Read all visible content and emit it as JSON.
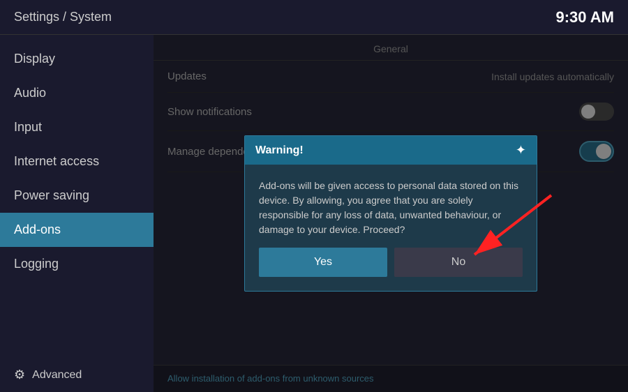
{
  "header": {
    "title": "Settings / System",
    "time": "9:30 AM"
  },
  "sidebar": {
    "items": [
      {
        "label": "Display",
        "active": false
      },
      {
        "label": "Audio",
        "active": false
      },
      {
        "label": "Input",
        "active": false
      },
      {
        "label": "Internet access",
        "active": false
      },
      {
        "label": "Power saving",
        "active": false
      },
      {
        "label": "Add-ons",
        "active": true
      },
      {
        "label": "Logging",
        "active": false
      }
    ],
    "footer": {
      "label": "Advanced",
      "icon": "gear"
    }
  },
  "main": {
    "section": {
      "label": "General"
    },
    "settings": [
      {
        "label": "Updates",
        "value": "Install updates automatically",
        "type": "text"
      },
      {
        "label": "Show notifications",
        "type": "toggle",
        "state": "off"
      },
      {
        "label": "Manage dependencies",
        "type": "toggle",
        "state": "on"
      }
    ],
    "status_bar": {
      "text": "Allow installation of add-ons from unknown sources"
    }
  },
  "dialog": {
    "title": "Warning!",
    "message": "Add-ons will be given access to personal data stored on this device. By allowing, you agree that you are solely responsible for any loss of data, unwanted behaviour, or damage to your device. Proceed?",
    "yes_label": "Yes",
    "no_label": "No",
    "icon": "✦"
  }
}
